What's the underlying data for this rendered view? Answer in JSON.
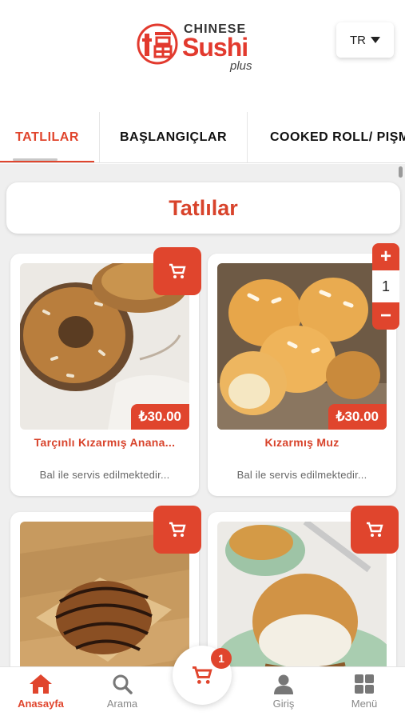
{
  "brand": {
    "line1": "CHINESE",
    "line2": "Sushi",
    "line3": "plus"
  },
  "language": {
    "selected": "TR"
  },
  "tabs": [
    {
      "label": "TATLILAR",
      "active": true
    },
    {
      "label": "BAŞLANGIÇLAR",
      "active": false
    },
    {
      "label": "COOKED ROLL/ PIŞM",
      "active": false
    }
  ],
  "section": {
    "title": "Tatlılar"
  },
  "products": [
    {
      "name": "Tarçınlı Kızarmış Anana...",
      "price": "₺30.00",
      "description": "Bal ile servis edilmektedir..."
    },
    {
      "name": "Kızarmış Muz",
      "price": "₺30.00",
      "description": "Bal ile servis edilmektedir...",
      "quantity": "1"
    },
    {
      "name": "",
      "price": "",
      "description": ""
    },
    {
      "name": "",
      "price": "",
      "description": ""
    }
  ],
  "quantity_controls": {
    "plus": "+",
    "minus": "−"
  },
  "bottom_nav": [
    {
      "label": "Anasayfa",
      "icon": "home-icon",
      "active": true
    },
    {
      "label": "Arama",
      "icon": "search-icon",
      "active": false
    },
    {
      "label": "Giriş",
      "icon": "user-icon",
      "active": false
    },
    {
      "label": "Menü",
      "icon": "grid-icon",
      "active": false
    }
  ],
  "cart": {
    "count": "1",
    "icon": "cart-icon"
  },
  "colors": {
    "accent": "#e0452d",
    "background": "#efefef"
  }
}
